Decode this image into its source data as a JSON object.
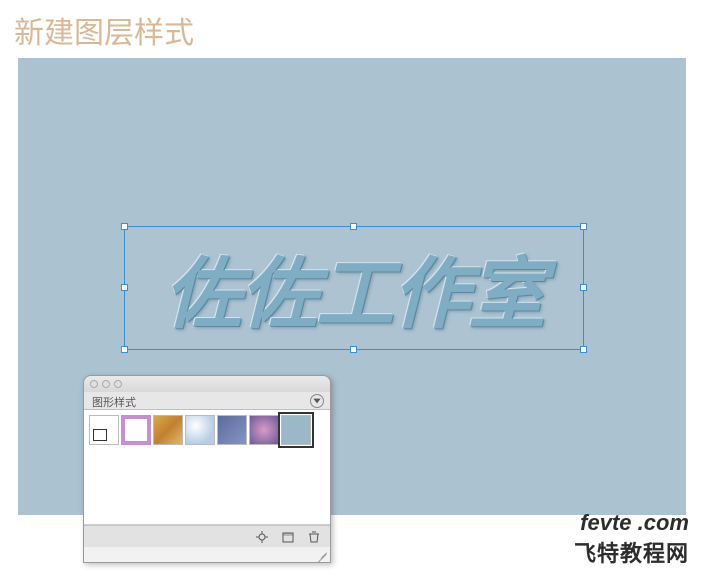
{
  "page_title": "新建图层样式",
  "canvas": {
    "main_text": "佐佐工作室"
  },
  "styles_panel": {
    "tab_label": "图形样式",
    "thumbnails": [
      {
        "name": "default-style"
      },
      {
        "name": "purple-border-style"
      },
      {
        "name": "gold-texture-style"
      },
      {
        "name": "sphere-gradient-style"
      },
      {
        "name": "blue-gray-style"
      },
      {
        "name": "nebula-style"
      },
      {
        "name": "flat-blue-style"
      }
    ],
    "selected_index": 6
  },
  "watermark": {
    "domain": "fevte .com",
    "site_name": "飞特教程网"
  }
}
